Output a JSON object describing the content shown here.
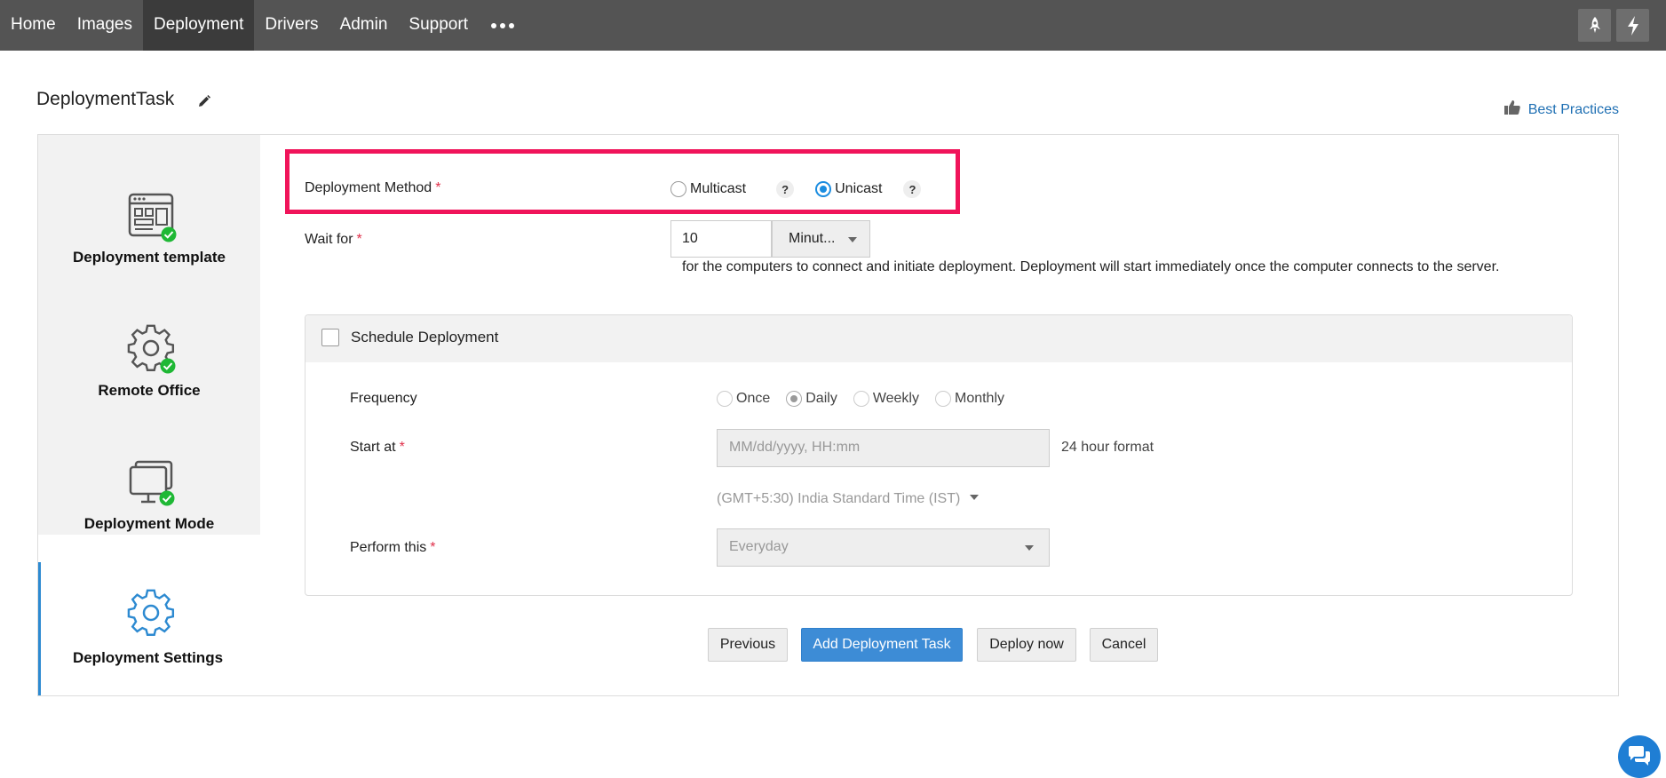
{
  "nav": {
    "items": [
      {
        "label": "Home",
        "active": false
      },
      {
        "label": "Images",
        "active": false
      },
      {
        "label": "Deployment",
        "active": true
      },
      {
        "label": "Drivers",
        "active": false
      },
      {
        "label": "Admin",
        "active": false
      },
      {
        "label": "Support",
        "active": false
      }
    ],
    "more_icon": "more-horizontal-icon",
    "right_icons": [
      "rocket-icon",
      "lightning-icon"
    ]
  },
  "header": {
    "title": "DeploymentTask",
    "edit_icon": "pencil-icon",
    "best_practices": "Best Practices",
    "best_practices_icon": "thumbs-up-icon"
  },
  "steps": [
    {
      "label": "Deployment template",
      "icon": "template-icon",
      "completed": true
    },
    {
      "label": "Remote Office",
      "icon": "gear-icon",
      "completed": true
    },
    {
      "label": "Deployment Mode",
      "icon": "monitor-icon",
      "completed": true
    },
    {
      "label": "Deployment Settings",
      "icon": "gear-icon",
      "completed": false,
      "active": true
    }
  ],
  "form": {
    "method": {
      "label": "Deployment Method",
      "required": "*",
      "options": [
        "Multicast",
        "Unicast"
      ],
      "selected": "Unicast",
      "help": "?"
    },
    "wait": {
      "label": "Wait for",
      "required": "*",
      "value": "10",
      "unit": "Minut...",
      "help_text": "for the computers to connect and initiate deployment. Deployment will start immediately once the computer connects to the server."
    },
    "schedule": {
      "label": "Schedule Deployment",
      "checked": false,
      "frequency_label": "Frequency",
      "frequency_options": [
        "Once",
        "Daily",
        "Weekly",
        "Monthly"
      ],
      "frequency_selected": "Daily",
      "start_label": "Start at",
      "required": "*",
      "start_placeholder": "MM/dd/yyyy, HH:mm",
      "format_note": "24 hour format",
      "timezone": "(GMT+5:30) India Standard Time (IST)",
      "perform_label": "Perform this",
      "perform_value": "Everyday"
    }
  },
  "buttons": {
    "previous": "Previous",
    "add": "Add Deployment Task",
    "deploy": "Deploy now",
    "cancel": "Cancel"
  },
  "colors": {
    "topbar": "#545454",
    "highlight": "#f0145a",
    "accent": "#2d8ad1",
    "success": "#1fb835"
  }
}
